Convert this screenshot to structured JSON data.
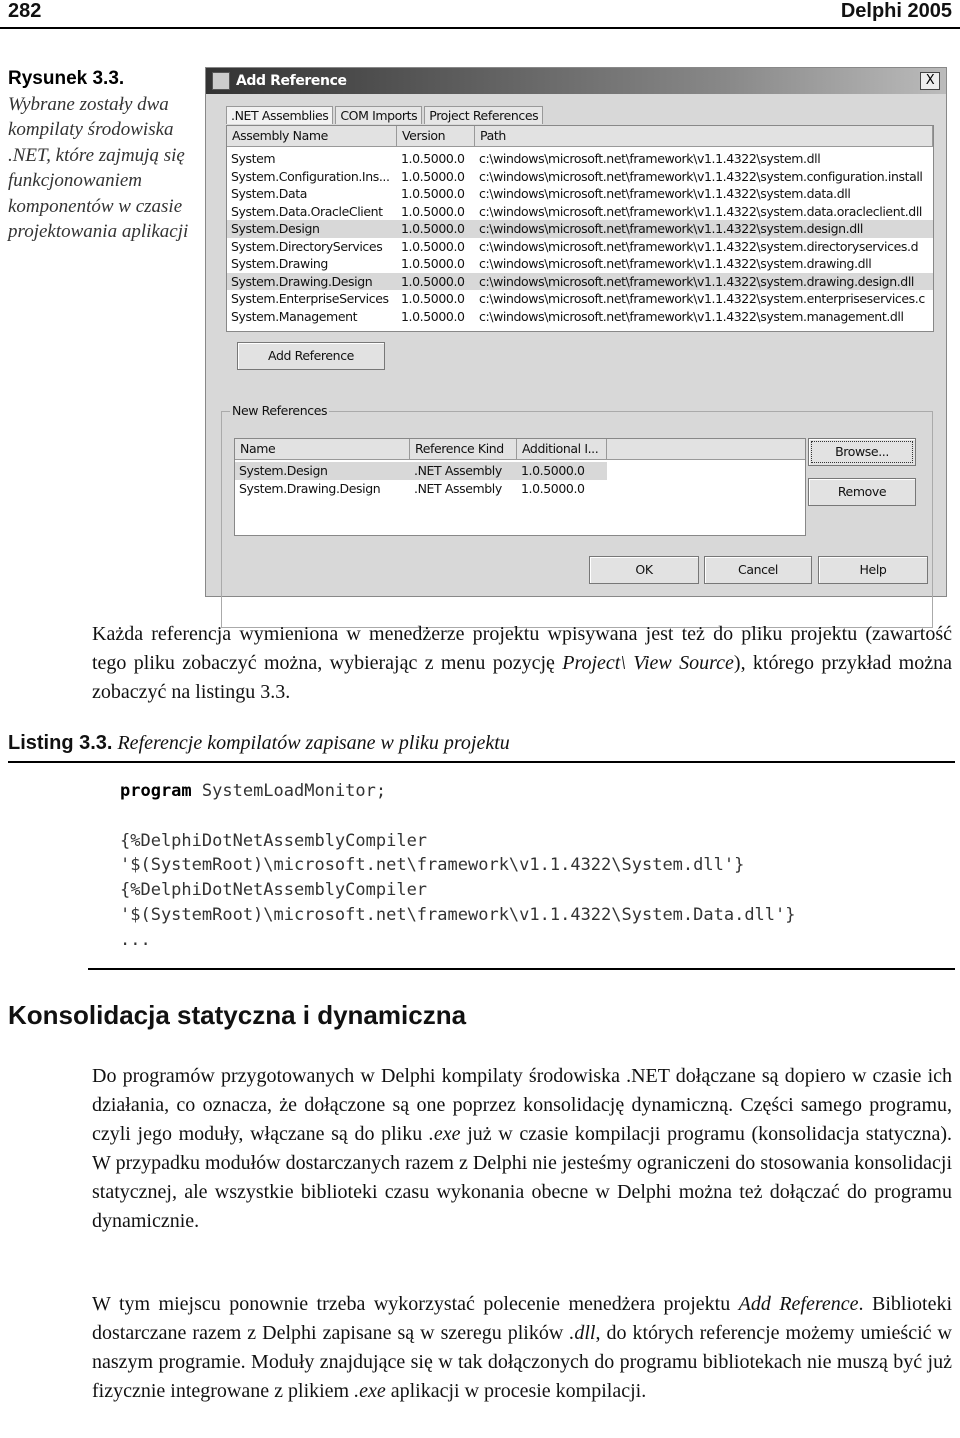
{
  "header": {
    "page_number": "282",
    "book_title": "Delphi 2005"
  },
  "figure": {
    "label": "Rysunek 3.3.",
    "caption": "Wybrane zostały dwa kompilaty środowiska .NET, które zajmują się funkcjonowaniem komponentów w czasie projektowania aplikacji"
  },
  "dialog": {
    "title": "Add Reference",
    "close": "X",
    "tabs": [
      ".NET Assemblies",
      "COM Imports",
      "Project References"
    ],
    "columns": [
      "Assembly Name",
      "Version",
      "Path"
    ],
    "rows": [
      {
        "name": "System",
        "version": "1.0.5000.0",
        "path": "c:\\windows\\microsoft.net\\framework\\v1.1.4322\\system.dll",
        "selected": false
      },
      {
        "name": "System.Configuration.Ins...",
        "version": "1.0.5000.0",
        "path": "c:\\windows\\microsoft.net\\framework\\v1.1.4322\\system.configuration.install",
        "selected": false
      },
      {
        "name": "System.Data",
        "version": "1.0.5000.0",
        "path": "c:\\windows\\microsoft.net\\framework\\v1.1.4322\\system.data.dll",
        "selected": false
      },
      {
        "name": "System.Data.OracleClient",
        "version": "1.0.5000.0",
        "path": "c:\\windows\\microsoft.net\\framework\\v1.1.4322\\system.data.oracleclient.dll",
        "selected": false
      },
      {
        "name": "System.Design",
        "version": "1.0.5000.0",
        "path": "c:\\windows\\microsoft.net\\framework\\v1.1.4322\\system.design.dll",
        "selected": true
      },
      {
        "name": "System.DirectoryServices",
        "version": "1.0.5000.0",
        "path": "c:\\windows\\microsoft.net\\framework\\v1.1.4322\\system.directoryservices.d",
        "selected": false
      },
      {
        "name": "System.Drawing",
        "version": "1.0.5000.0",
        "path": "c:\\windows\\microsoft.net\\framework\\v1.1.4322\\system.drawing.dll",
        "selected": false
      },
      {
        "name": "System.Drawing.Design",
        "version": "1.0.5000.0",
        "path": "c:\\windows\\microsoft.net\\framework\\v1.1.4322\\system.drawing.design.dll",
        "selected": true
      },
      {
        "name": "System.EnterpriseServices",
        "version": "1.0.5000.0",
        "path": "c:\\windows\\microsoft.net\\framework\\v1.1.4322\\system.enterpriseservices.c",
        "selected": false
      },
      {
        "name": "System.Management",
        "version": "1.0.5000.0",
        "path": "c:\\windows\\microsoft.net\\framework\\v1.1.4322\\system.management.dll",
        "selected": false
      }
    ],
    "add_reference": "Add Reference",
    "new_references": {
      "label": "New References",
      "columns": [
        "Name",
        "Reference Kind",
        "Additional I..."
      ],
      "rows": [
        [
          "System.Design",
          ".NET Assembly",
          "1.0.5000.0"
        ],
        [
          "System.Drawing.Design",
          ".NET Assembly",
          "1.0.5000.0"
        ]
      ]
    },
    "browse": "Browse...",
    "remove": "Remove",
    "ok": "OK",
    "cancel": "Cancel",
    "help": "Help"
  },
  "para1": {
    "text1": "Każda referencja wymieniona w menedżerze projektu wpisywana jest też do pliku projektu (zawartość tego pliku zobaczyć można, wybierając z menu pozycję ",
    "italic": "Project\\ View Source",
    "text2": "), którego przykład można zobaczyć na listingu 3.3."
  },
  "listing": {
    "label": "Listing 3.3.",
    "title": "Referencje kompilatów zapisane w pliku projektu",
    "keyword": "program",
    "line1_rest": " SystemLoadMonitor;",
    "lines": [
      "{%DelphiDotNetAssemblyCompiler",
      "'$(SystemRoot)\\microsoft.net\\framework\\v1.1.4322\\System.dll'}",
      "{%DelphiDotNetAssemblyCompiler",
      "'$(SystemRoot)\\microsoft.net\\framework\\v1.1.4322\\System.Data.dll'}",
      "..."
    ]
  },
  "section": {
    "heading": "Konsolidacja statyczna i dynamiczna",
    "p1a": "Do programów przygotowanych w Delphi kompilaty środowiska .NET dołączane są dopiero w czasie ich działania, co oznacza, że dołączone są one poprzez konsolidację dynamiczną. Części samego programu, czyli jego moduły, włączane są do pliku ",
    "p1i": ".exe",
    "p1b": " już w czasie kompilacji programu (konsolidacja statyczna). W przypadku modułów dostarczanych razem z Delphi nie jesteśmy ograniczeni do stosowania konsolidacji statycznej, ale wszystkie biblioteki czasu wykonania obecne w Delphi można też dołączać do programu dynamicznie.",
    "p2a": "W tym miejscu ponownie trzeba wykorzystać polecenie menedżera projektu ",
    "p2i1": "Add Reference",
    "p2b": ". Biblioteki dostarczane razem z Delphi zapisane są w szeregu plików ",
    "p2i2": ".dll",
    "p2c": ", do których referencje możemy umieścić w naszym programie. Moduły znajdujące się w tak dołączonych do programu bibliotekach nie muszą być już fizycznie integrowane z plikiem ",
    "p2i3": ".exe",
    "p2d": " aplikacji w procesie kompilacji."
  }
}
